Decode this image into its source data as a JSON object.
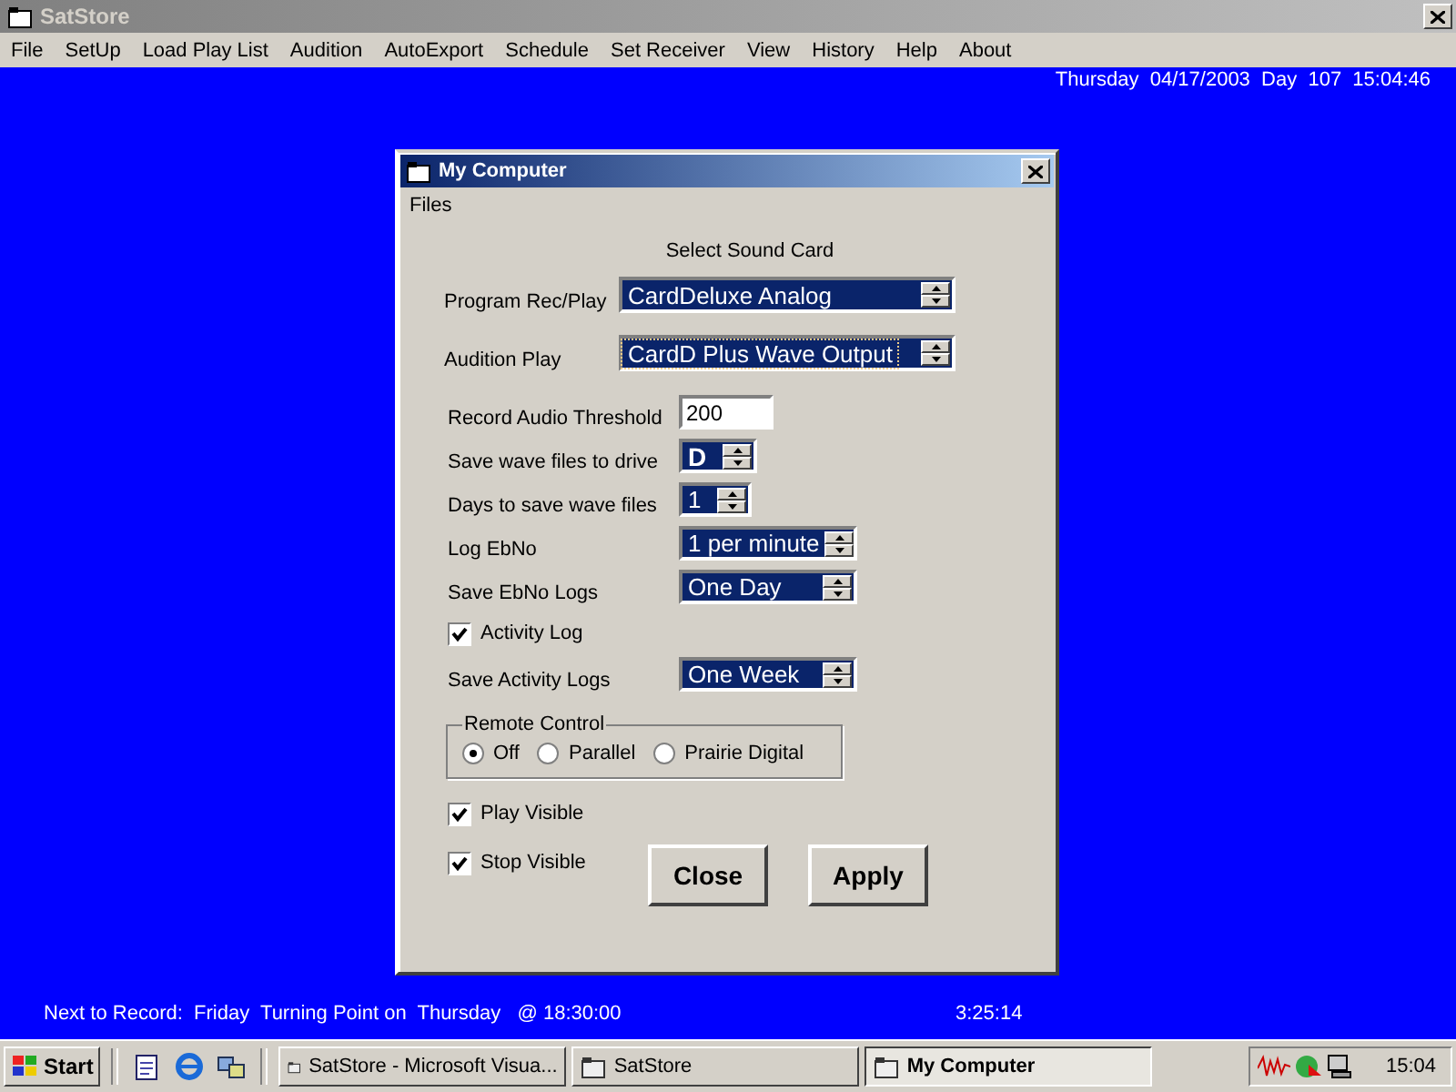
{
  "window": {
    "title": "SatStore"
  },
  "menu": [
    "File",
    "SetUp",
    "Load Play List",
    "Audition",
    "AutoExport",
    "Schedule",
    "Set Receiver",
    "View",
    "History",
    "Help",
    "About"
  ],
  "clock": "Thursday  04/17/2003  Day  107  15:04:46",
  "dialog": {
    "title": "My Computer",
    "menu": [
      "Files"
    ],
    "heading": "Select Sound Card",
    "sound_cards": [
      {
        "label": "Program Rec/Play",
        "value": "CardDeluxe Analog",
        "focused": false
      },
      {
        "label": "Audition Play",
        "value": "CardD Plus Wave Output",
        "focused": true
      }
    ],
    "settings": [
      {
        "kind": "text",
        "label": "Record Audio Threshold",
        "value": "200"
      },
      {
        "kind": "spin",
        "label": "Save wave files to drive",
        "value": "D"
      },
      {
        "kind": "spin",
        "label": "Days to save wave files",
        "value": "1"
      },
      {
        "kind": "combo",
        "label": "Log EbNo",
        "value": "1 per minute"
      },
      {
        "kind": "combo",
        "label": "Save EbNo Logs",
        "value": "One Day"
      },
      {
        "kind": "check",
        "label": "Activity Log",
        "checked": true
      },
      {
        "kind": "combo",
        "label": "Save Activity Logs",
        "value": "One Week"
      }
    ],
    "remote_control": {
      "title": "Remote Control",
      "options": [
        {
          "label": "Off",
          "selected": true
        },
        {
          "label": "Parallel",
          "selected": false
        },
        {
          "label": "Prairie Digital",
          "selected": false
        }
      ]
    },
    "checks": [
      {
        "label": "Play Visible",
        "checked": true
      },
      {
        "label": "Stop Visible",
        "checked": true
      }
    ],
    "buttons": [
      {
        "label": "Close"
      },
      {
        "label": "Apply"
      }
    ]
  },
  "status": {
    "next": "Next to Record:  Friday  Turning Point on  Thursday   @ 18:30:00",
    "timer": "3:25:14"
  },
  "taskbar": {
    "start": "Start",
    "tasks": [
      {
        "label": "SatStore - Microsoft Visua...",
        "selected": false
      },
      {
        "label": "SatStore",
        "selected": false
      },
      {
        "label": "My Computer",
        "selected": true
      }
    ],
    "time": "15:04"
  }
}
